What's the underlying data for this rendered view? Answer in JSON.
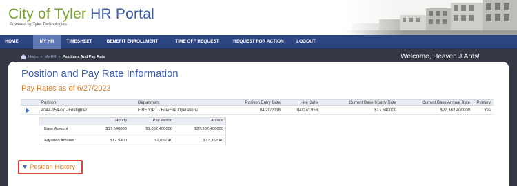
{
  "header": {
    "title_prefix": "City of Tyler",
    "title_accent": "HR Portal",
    "powered_by": "Powered by Tyler Technologies"
  },
  "nav": {
    "items": [
      {
        "label": "HOME",
        "active": false
      },
      {
        "label": "MY HR",
        "active": true
      },
      {
        "label": "TIMESHEET",
        "active": false
      },
      {
        "label": "BENEFIT ENROLLMENT",
        "active": false
      },
      {
        "label": "TIME OFF REQUEST",
        "active": false
      },
      {
        "label": "REQUEST FOR ACTION",
        "active": false
      },
      {
        "label": "LOGOUT",
        "active": false
      }
    ]
  },
  "breadcrumb": {
    "items": [
      "Home",
      "My HR",
      "Positions And Pay Rate"
    ]
  },
  "welcome": "Welcome, Heaven J Ards!",
  "page_title": "Position and Pay Rate Information",
  "pay_rates_title": "Pay Rates as of 6/27/2023",
  "main_table": {
    "headers": {
      "position": "Position",
      "department": "Department",
      "entry_date": "Position Entry Date",
      "hire_date": "Hire Date",
      "hourly_rate": "Current Base Hourly Rate",
      "annual_rate": "Current Base Annual Rate",
      "primary": "Primary"
    },
    "row": {
      "position": "4044-154-07 - Firefighter",
      "department": "FIRE*OPT - Fire/Fire Operations",
      "entry_date": "04/20/2018",
      "hire_date": "04/07/1958",
      "hourly_rate": "$17.540000",
      "annual_rate": "$27,362.400000",
      "primary": "Yes"
    }
  },
  "detail_table": {
    "headers": {
      "hourly": "Hourly",
      "pay_period": "Pay Period",
      "annual": "Annual"
    },
    "rows": [
      {
        "label": "Base Amount",
        "hourly": "$17.540000",
        "pay_period": "$1,052.400000",
        "annual": "$27,362.400000"
      },
      {
        "label": "Adjusted Amount",
        "hourly": "$17.5400",
        "pay_period": "$1,052.40",
        "annual": "$27,362.40"
      }
    ]
  },
  "position_history": "Position History",
  "colors": {
    "nav_bg": "#2c4480",
    "nav_active": "#5f79b6",
    "title_blue": "#3b5aa3",
    "accent_orange": "#d9822b",
    "logo_green": "#78a22f",
    "highlight_red": "#e0423f"
  }
}
